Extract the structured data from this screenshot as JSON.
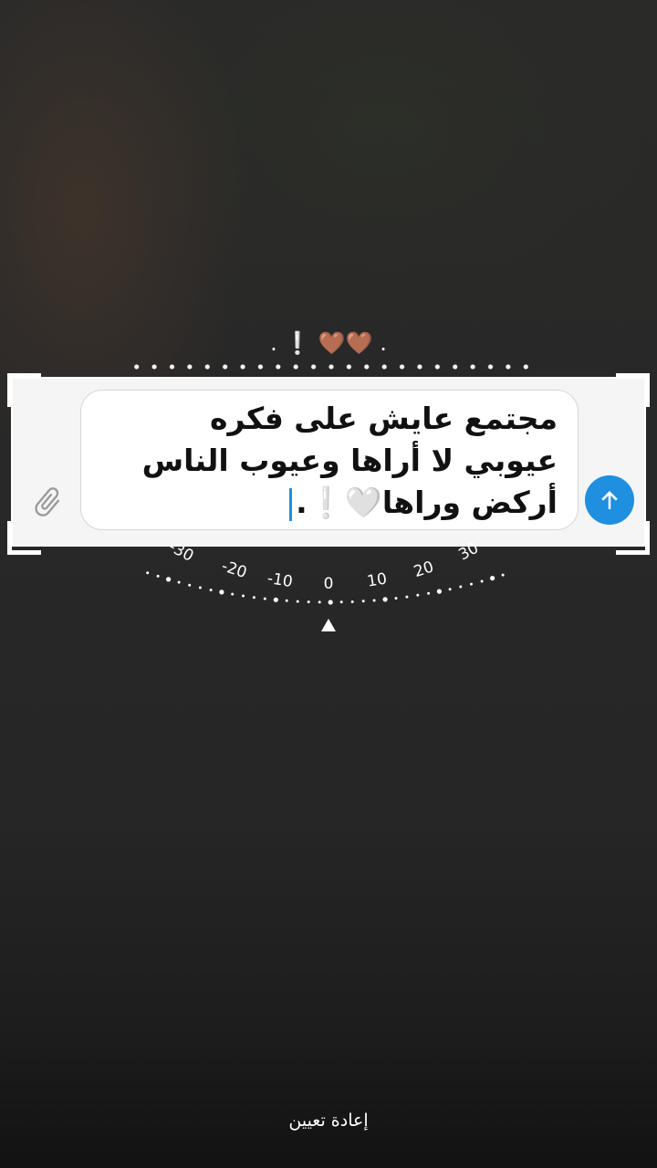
{
  "caption": {
    "text": ". 🤎🤎 ❕ ."
  },
  "composer": {
    "message_lines": [
      "مجتمع عايش على فكره",
      "عيوبي لا أراها وعيوب الناس",
      "أركض وراها🤍❕."
    ],
    "attach_icon": "paperclip-icon",
    "send_icon": "arrow-up-icon",
    "accent_color": "#1f8fe0"
  },
  "rotation_dial": {
    "labels": [
      "-30",
      "-20",
      "-10",
      "0",
      "10",
      "20",
      "30"
    ],
    "indicator_icon": "triangle-up-icon"
  },
  "footer": {
    "reset_label": "إعادة تعيين"
  }
}
